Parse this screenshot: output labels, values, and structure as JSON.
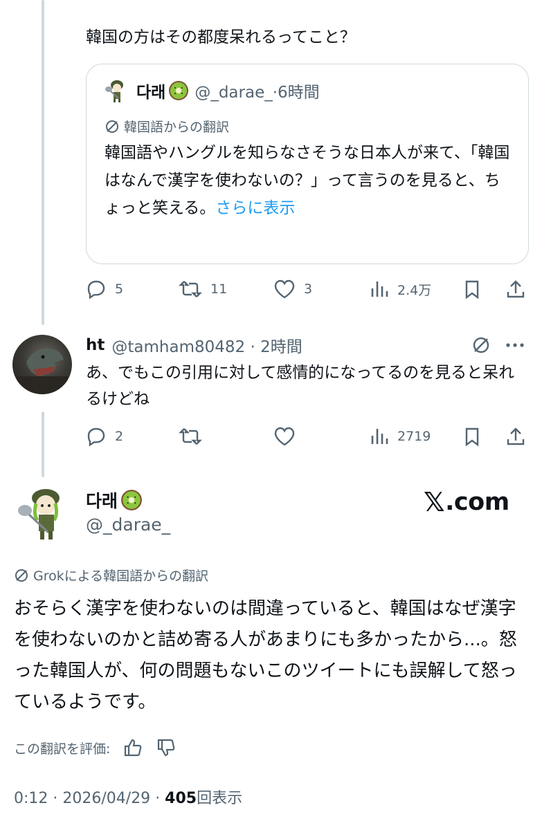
{
  "tweet1": {
    "text": "韓国の方はその都度呆れるってこと？",
    "quote": {
      "name": "다래",
      "handle_time": "@_darae_·6時間",
      "translation_label": "韓国語からの翻訳",
      "body": "韓国語やハングルを知らなさそうな日本人が来て、「韓国はなんで漢字を使わないの？」って言うのを見ると、ちょっと笑える。",
      "show_more": "さらに表示"
    },
    "replies": "5",
    "retweets": "11",
    "likes": "3",
    "views": "2.4万"
  },
  "tweet2": {
    "name": "ht",
    "handle_time": "@tamham80482 · 2時間",
    "body": "あ、でもこの引用に対して感情的になってるのを見ると呆れるけどね",
    "replies": "2",
    "retweets": "",
    "likes": "",
    "views": "2719"
  },
  "main": {
    "name": "다래",
    "handle": "@_darae_",
    "watermark": ".com",
    "translation_label": "Grokによる韓国語からの翻訳",
    "body": "おそらく漢字を使わないのは間違っていると、韓国はなぜ漢字を使わないのかと詰め寄る人があまりにも多かったから...。怒った韓国人が、何の問題もないこのツイートにも誤解して怒っているようです。",
    "rate_label": "この翻訳を評価:",
    "time": "0:12 · 2026/04/29 · ",
    "views": "405",
    "views_label": "回表示"
  },
  "colors": {
    "accent": "#1d9bf0",
    "muted": "#536471",
    "border": "#cfd9de",
    "text": "#0f1419"
  }
}
